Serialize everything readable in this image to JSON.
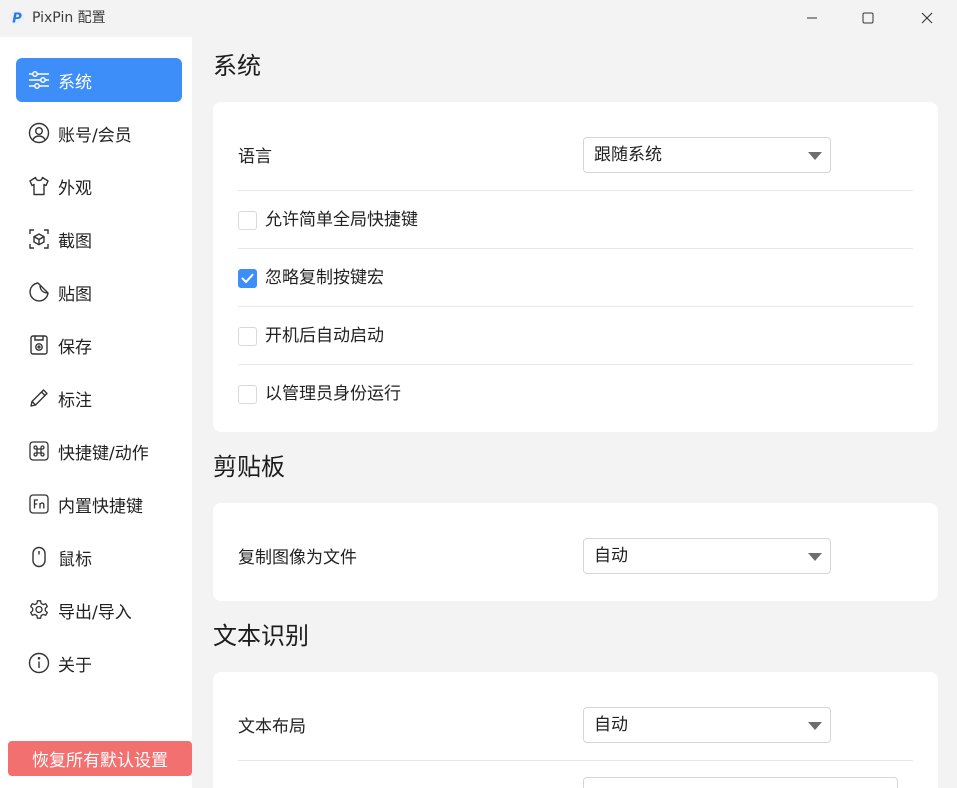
{
  "window": {
    "title": "PixPin 配置"
  },
  "sidebar": {
    "items": [
      {
        "label": "系统",
        "icon": "sliders-icon",
        "active": true
      },
      {
        "label": "账号/会员",
        "icon": "user-circle-icon",
        "active": false
      },
      {
        "label": "外观",
        "icon": "shirt-icon",
        "active": false
      },
      {
        "label": "截图",
        "icon": "screenshot-box-icon",
        "active": false
      },
      {
        "label": "贴图",
        "icon": "sticker-icon",
        "active": false
      },
      {
        "label": "保存",
        "icon": "save-icon",
        "active": false
      },
      {
        "label": "标注",
        "icon": "pencil-icon",
        "active": false
      },
      {
        "label": "快捷键/动作",
        "icon": "command-key-icon",
        "active": false
      },
      {
        "label": "内置快捷键",
        "icon": "fn-key-icon",
        "active": false
      },
      {
        "label": "鼠标",
        "icon": "mouse-icon",
        "active": false
      },
      {
        "label": "导出/导入",
        "icon": "gear-icon",
        "active": false
      },
      {
        "label": "关于",
        "icon": "info-icon",
        "active": false
      }
    ],
    "reset_label": "恢复所有默认设置"
  },
  "sections": {
    "system": {
      "title": "系统",
      "language_label": "语言",
      "language_value": "跟随系统",
      "options": [
        {
          "label": "允许简单全局快捷键",
          "checked": false
        },
        {
          "label": "忽略复制按键宏",
          "checked": true
        },
        {
          "label": "开机后自动启动",
          "checked": false
        },
        {
          "label": "以管理员身份运行",
          "checked": false
        }
      ]
    },
    "clipboard": {
      "title": "剪贴板",
      "copy_label": "复制图像为文件",
      "copy_value": "自动"
    },
    "ocr": {
      "title": "文本识别",
      "layout_label": "文本布局",
      "layout_value": "自动"
    }
  },
  "colors": {
    "accent": "#3d8ef8",
    "reset_button": "#f27170",
    "background": "#f3f3f3"
  }
}
